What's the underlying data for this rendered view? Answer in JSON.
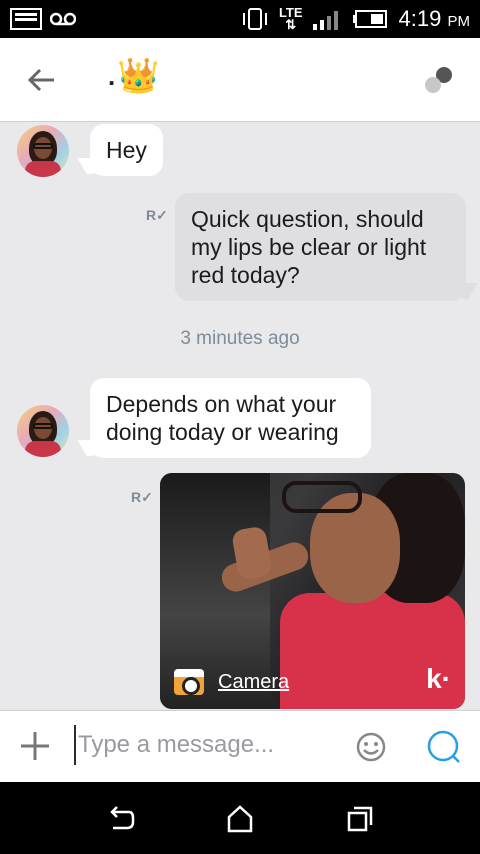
{
  "status_bar": {
    "network": "LTE",
    "time": "4:19",
    "ampm": "PM"
  },
  "header": {
    "title": ".",
    "crown_icon": "crown-icon"
  },
  "messages": [
    {
      "direction": "in",
      "text": "Hey"
    },
    {
      "direction": "out",
      "text": "Quick question, should my lips be clear or light red today?",
      "receipt": "R"
    },
    {
      "direction": "in",
      "text": "Depends on what your doing today or wearing"
    },
    {
      "direction": "out",
      "type": "photo",
      "caption": "Camera",
      "receipt": "R",
      "watermark": "k·"
    }
  ],
  "timestamp": "3 minutes ago",
  "composer": {
    "placeholder": "Type a message..."
  },
  "colors": {
    "accent": "#2a9fe0",
    "muted": "#7e8b99"
  }
}
